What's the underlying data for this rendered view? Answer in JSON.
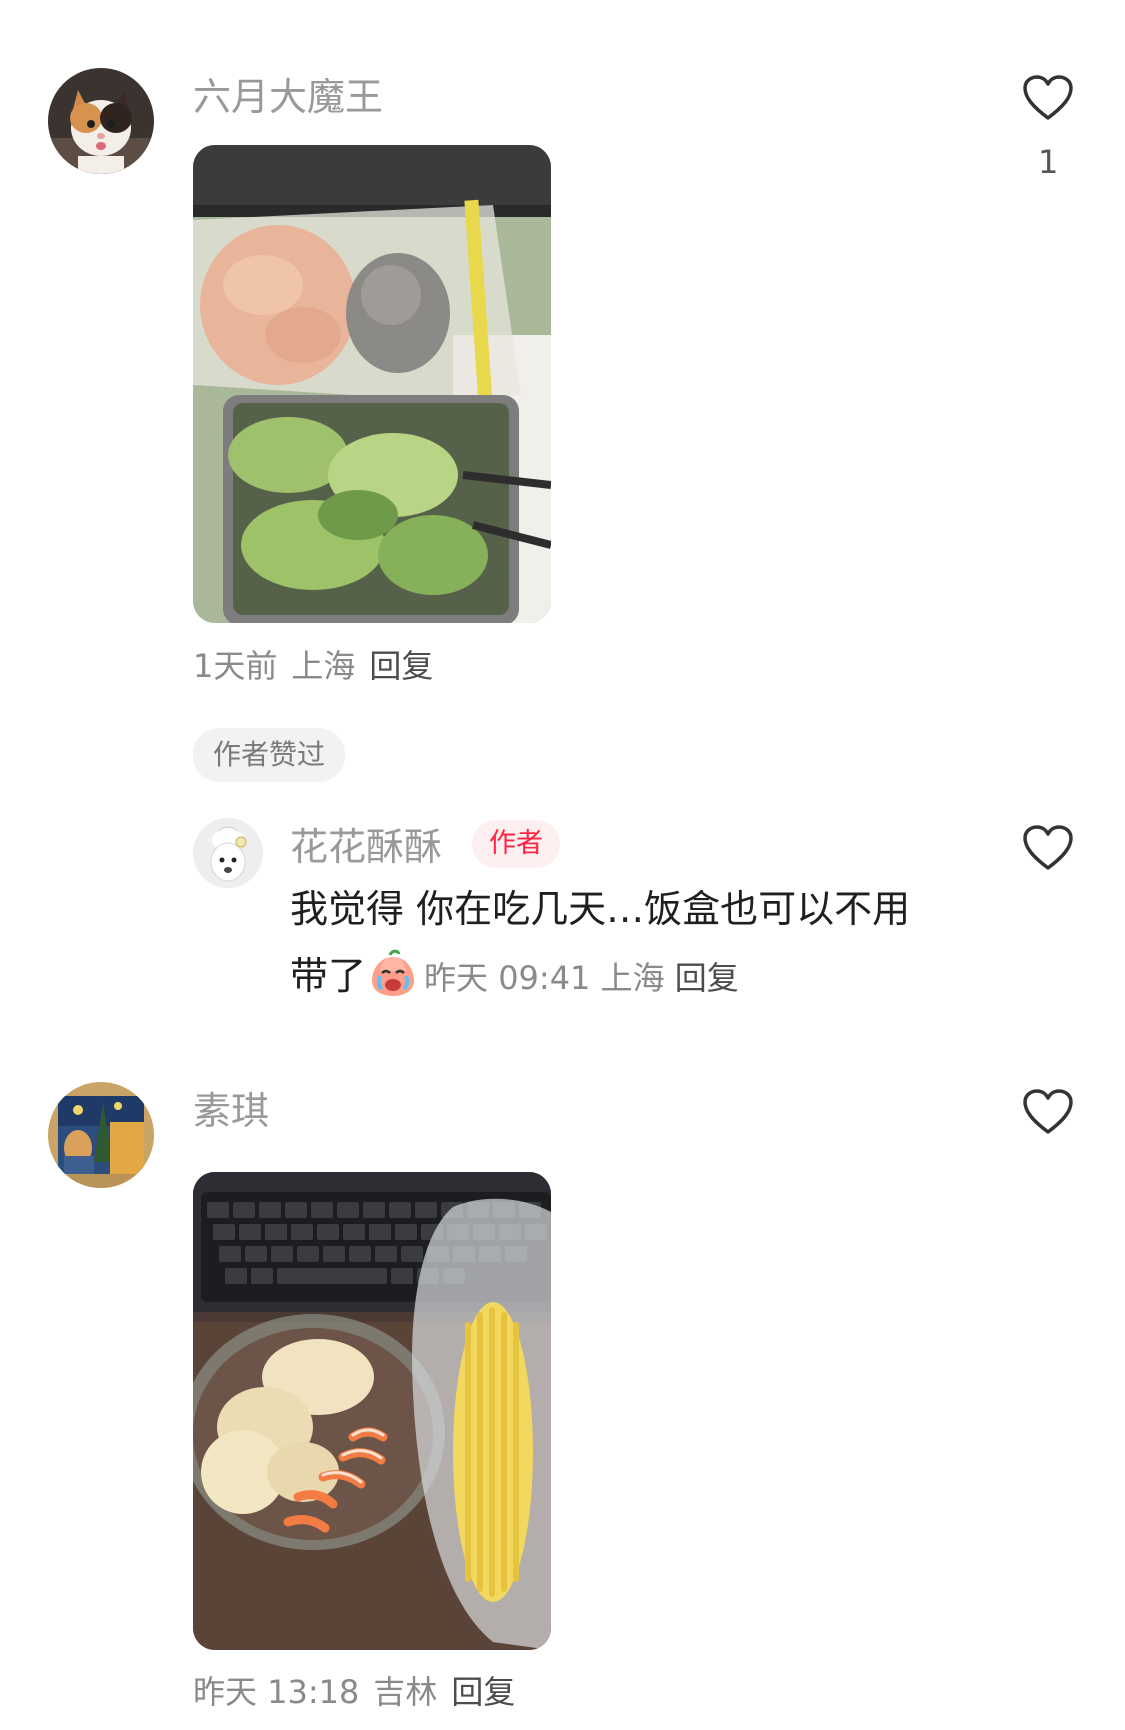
{
  "comments": [
    {
      "username": "六月大魔王",
      "avatar_icon": "cat-avatar",
      "photo_desc": "lunch-box-photo",
      "like_count": "1",
      "time": "1天前",
      "location": "上海",
      "reply_label": "回复",
      "author_liked_label": "作者赞过",
      "replies": [
        {
          "username": "花花酥酥",
          "avatar_icon": "poodle-avatar",
          "badge": "作者",
          "text": "我觉得 你在吃几天…饭盒也可以不用带了",
          "text_line1": "我觉得 你在吃几天…饭盒也可以不用",
          "text_line2": "带了",
          "emoji_icon": "crying-emoji-icon",
          "time": "昨天 09:41",
          "location": "上海",
          "reply_label": "回复"
        }
      ]
    },
    {
      "username": "素琪",
      "avatar_icon": "painting-avatar",
      "photo_desc": "dumplings-corn-photo",
      "time": "昨天 13:18",
      "location": "吉林",
      "reply_label": "回复"
    }
  ],
  "colors": {
    "username": "#999999",
    "author_badge": "#ff2442",
    "author_badge_bg": "#fdeef0",
    "reply_link": "#4d4d4d",
    "meta": "#8a8a8a"
  }
}
